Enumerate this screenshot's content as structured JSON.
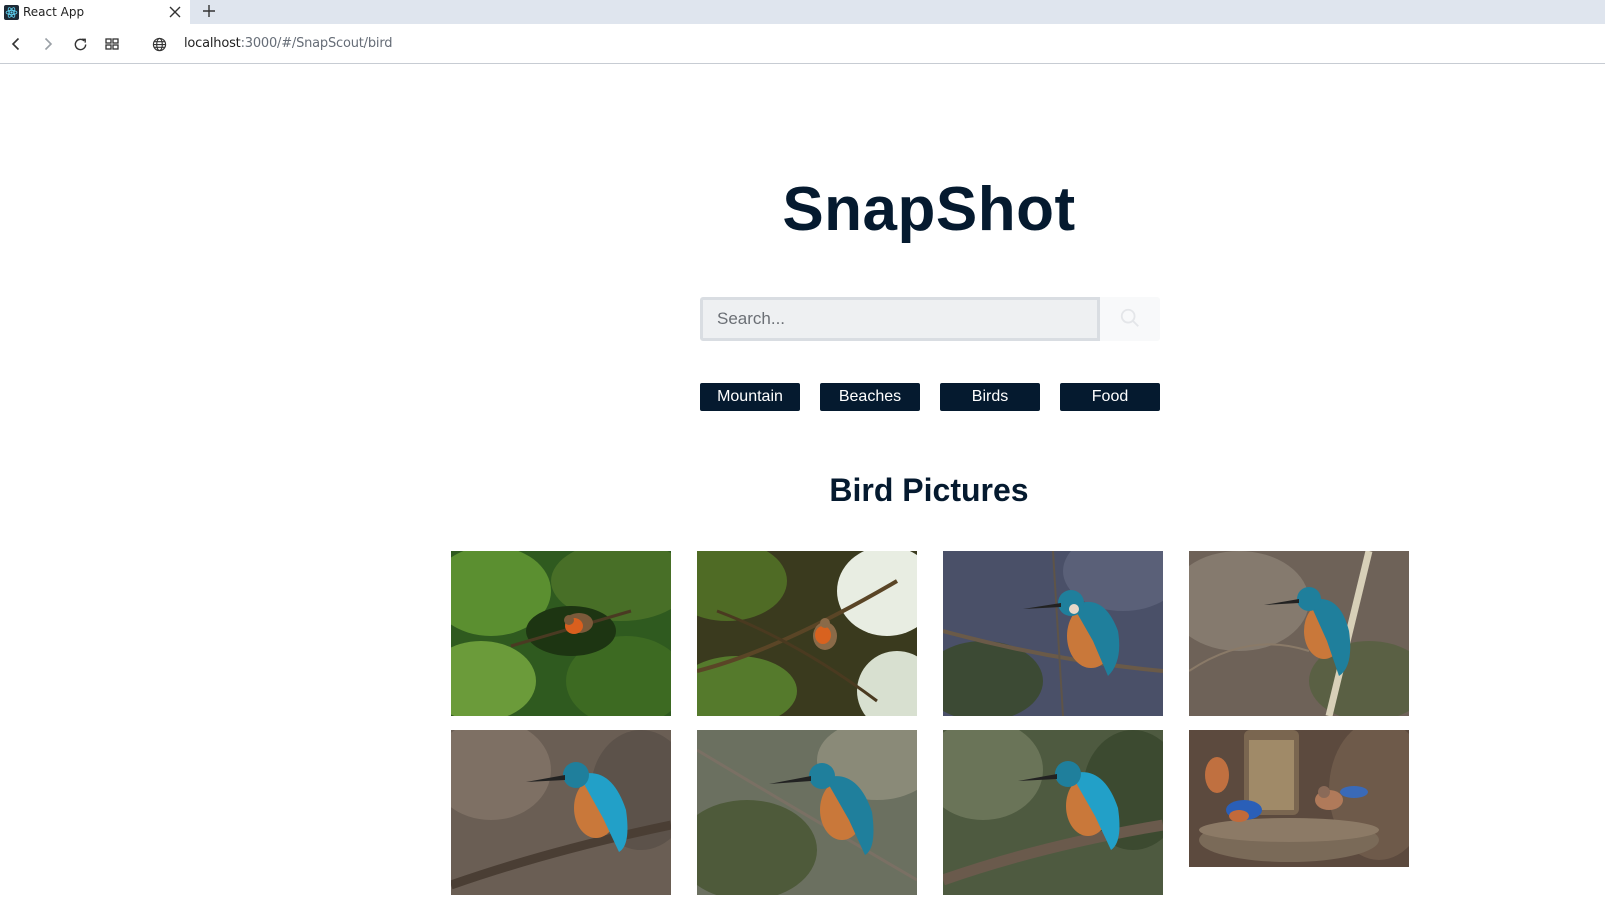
{
  "browser": {
    "tab_title": "React App",
    "url_host": "localhost",
    "url_path": ":3000/#/SnapScout/bird"
  },
  "page": {
    "title": "SnapShot",
    "search": {
      "placeholder": "Search...",
      "value": ""
    },
    "nav": [
      "Mountain",
      "Beaches",
      "Birds",
      "Food"
    ],
    "section_title": "Bird Pictures"
  },
  "colors": {
    "brand": "#051a2f",
    "search_bg": "#eef0f2"
  },
  "gallery": {
    "count": 8,
    "images": [
      {
        "subject": "robin-in-conifer"
      },
      {
        "subject": "robin-in-branches"
      },
      {
        "subject": "kingfisher-on-branch"
      },
      {
        "subject": "kingfisher-on-twig"
      },
      {
        "subject": "kingfisher-perched"
      },
      {
        "subject": "kingfisher-on-stem"
      },
      {
        "subject": "kingfisher-on-log"
      },
      {
        "subject": "bluebirds-at-feeder"
      }
    ]
  }
}
